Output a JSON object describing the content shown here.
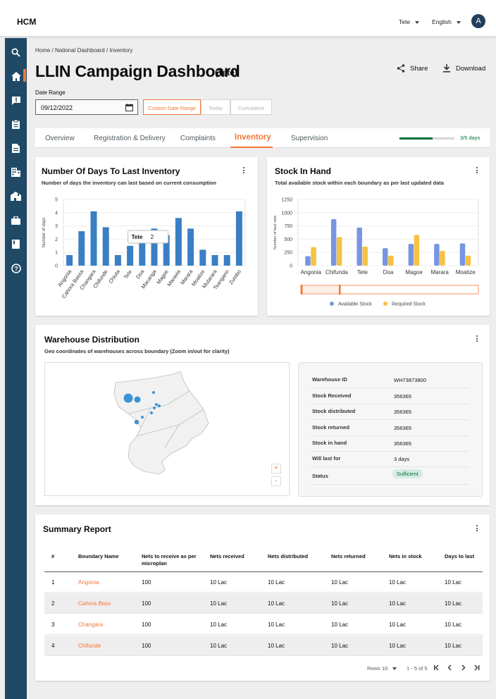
{
  "topbar": {
    "brand": "HCM",
    "location": "Tete",
    "language": "English",
    "avatar_initial": "A"
  },
  "sidebar": {
    "icons": [
      "search-icon",
      "home-icon",
      "complaint-icon",
      "clipboard-icon",
      "document-icon",
      "building-icon",
      "house-icon",
      "briefcase-icon",
      "book-icon",
      "help-icon"
    ],
    "active_index": 1
  },
  "breadcrumb": "Home  /  National Dashboard  /  Inventory",
  "page": {
    "title": "LLIN Campaign Dashboard",
    "subtitle": "(Tete)",
    "share": "Share",
    "download": "Download"
  },
  "date": {
    "label": "Date Range",
    "value": "09/12/2022",
    "btn_custom": "Custom Date Range",
    "btn_today": "Today",
    "btn_cumulative": "Cumulative"
  },
  "tabs": {
    "items": [
      "Overview",
      "Registration & Delivery",
      "Complaints",
      "Inventory",
      "Supervision"
    ],
    "active": "Inventory",
    "progress_text": "3/5 days",
    "progress_fraction": 0.6
  },
  "days_chart": {
    "title": "Number Of Days To Last Inventory",
    "subtitle": "Number of days the inventory can last based on current consumption",
    "tooltip_label": "Tete",
    "tooltip_value": "2"
  },
  "stock_chart": {
    "title": "Stock In Hand",
    "subtitle": "Total available stock within each boundary as per last updated data"
  },
  "warehouse": {
    "title": "Warehouse Distribution",
    "subtitle": "Geo coordinates of warehouses across boundary (Zoom in/out for clarity)",
    "zoom_in": "+",
    "zoom_out": "-",
    "rows": [
      {
        "k": "Warehouse ID",
        "v": "WH73873800"
      },
      {
        "k": "Stock Received",
        "v": "356365"
      },
      {
        "k": "Stock distributed",
        "v": "356365"
      },
      {
        "k": "Stock returned",
        "v": "356365"
      },
      {
        "k": "Stock in hand",
        "v": "356365"
      },
      {
        "k": "Will last for",
        "v": "3 days"
      },
      {
        "k": "Status",
        "v": "Sufficient"
      }
    ]
  },
  "summary": {
    "title": "Summary Report",
    "headers": [
      "#",
      "Boundary Name",
      "Nets to receive as per microplan",
      "Nets received",
      "Nets distributed",
      "Nets returned",
      "Nets in stock",
      "Days to last"
    ],
    "rows": [
      [
        "1",
        "Angonia",
        "100",
        "10 Lac",
        "10 Lac",
        "10 Lac",
        "10 Lac",
        "10 Lac"
      ],
      [
        "2",
        "Cahora Bass",
        "100",
        "10 Lac",
        "10 Lac",
        "10 Lac",
        "10 Lac",
        "10 Lac"
      ],
      [
        "3",
        "Changara",
        "100",
        "10 Lac",
        "10 Lac",
        "10 Lac",
        "10 Lac",
        "10 Lac"
      ],
      [
        "4",
        "Chifunde",
        "100",
        "10 Lac",
        "10 Lac",
        "10 Lac",
        "10 Lac",
        "10 Lac"
      ]
    ],
    "rows_label": "Rows",
    "rows_value": "10",
    "page_range": "1 - 5 of 5"
  },
  "colors": {
    "accent": "#f47738",
    "sidebar": "#1f4967",
    "bar_days": "#3a7fc4",
    "available": "#7895e2",
    "required": "#f5c243",
    "green": "#00703c"
  },
  "chart_data": [
    {
      "type": "bar",
      "title": "Number Of Days To Last Inventory",
      "xlabel": "",
      "ylabel": "Number of days",
      "ylim": [
        0,
        5
      ],
      "yticks": [
        0,
        1,
        2,
        3,
        4,
        5
      ],
      "categories": [
        "Angonia",
        "Cahora Bassa",
        "Changara",
        "Chifunde",
        "Chiuta",
        "Tete",
        "Doa",
        "Macanga",
        "Magoe",
        "Maravia",
        "Marara",
        "Moatize",
        "Mutarara",
        "Tsangano",
        "Zumbo"
      ],
      "values": [
        0.8,
        2.6,
        4.1,
        2.9,
        0.8,
        1.5,
        2.3,
        2.8,
        2.3,
        3.6,
        2.8,
        1.2,
        0.8,
        0.8,
        4.1
      ]
    },
    {
      "type": "bar",
      "title": "Stock In Hand",
      "xlabel": "",
      "ylabel": "Number of bed nets",
      "ylim": [
        0,
        1250
      ],
      "yticks": [
        0,
        250,
        500,
        750,
        1000,
        1250
      ],
      "categories": [
        "Angonia",
        "Chifunda",
        "Tete",
        "Doa",
        "Magoe",
        "Marara",
        "Moatize"
      ],
      "series": [
        {
          "name": "Available Stock",
          "values": [
            180,
            880,
            720,
            330,
            410,
            410,
            420
          ]
        },
        {
          "name": "Required Stock",
          "values": [
            350,
            540,
            360,
            190,
            580,
            280,
            190
          ]
        }
      ],
      "legend": "bottom"
    }
  ]
}
